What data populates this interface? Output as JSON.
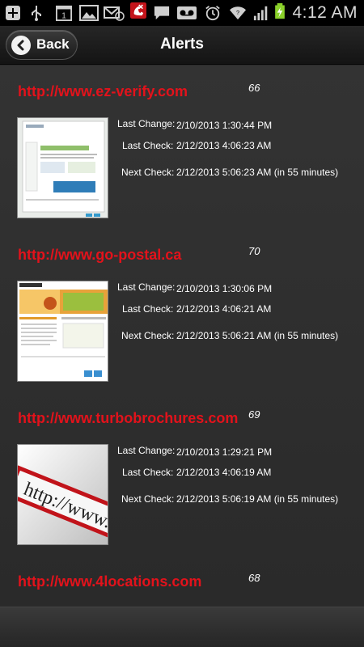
{
  "status_bar": {
    "time": "4:12 AM",
    "icons": [
      "add-icon",
      "usb-icon",
      "calendar-icon",
      "gallery-icon",
      "email-icon",
      "missed-call-icon",
      "message-icon",
      "voicemail-icon",
      "alarm-icon",
      "wifi-icon",
      "signal-icon",
      "battery-icon"
    ],
    "calendar_day": "1"
  },
  "header": {
    "back_label": "Back",
    "title": "Alerts"
  },
  "labels": {
    "last_change": "Last Change:",
    "last_check": "Last Check:",
    "next_check": "Next Check:"
  },
  "alerts": [
    {
      "url": "http://www.ez-verify.com",
      "count": "66",
      "last_change": "2/10/2013 1:30:44 PM",
      "last_check": "2/12/2013 4:06:23 AM",
      "next_check": "2/12/2013 5:06:23 AM (in 55 minutes)"
    },
    {
      "url": "http://www.go-postal.ca",
      "count": "70",
      "last_change": "2/10/2013 1:30:06 PM",
      "last_check": "2/12/2013 4:06:21 AM",
      "next_check": "2/12/2013 5:06:21 AM (in 55 minutes)"
    },
    {
      "url": "http://www.turbobrochures.com",
      "count": "69",
      "last_change": "2/10/2013 1:29:21 PM",
      "last_check": "2/12/2013 4:06:19 AM",
      "next_check": "2/12/2013 5:06:19 AM (in 55 minutes)",
      "thumb_text": "http://www."
    },
    {
      "url": "http://www.4locations.com",
      "count": "68"
    }
  ],
  "colors": {
    "url_red": "#e3121b",
    "background": "#2b2b2b",
    "status_bar": "#000000"
  }
}
